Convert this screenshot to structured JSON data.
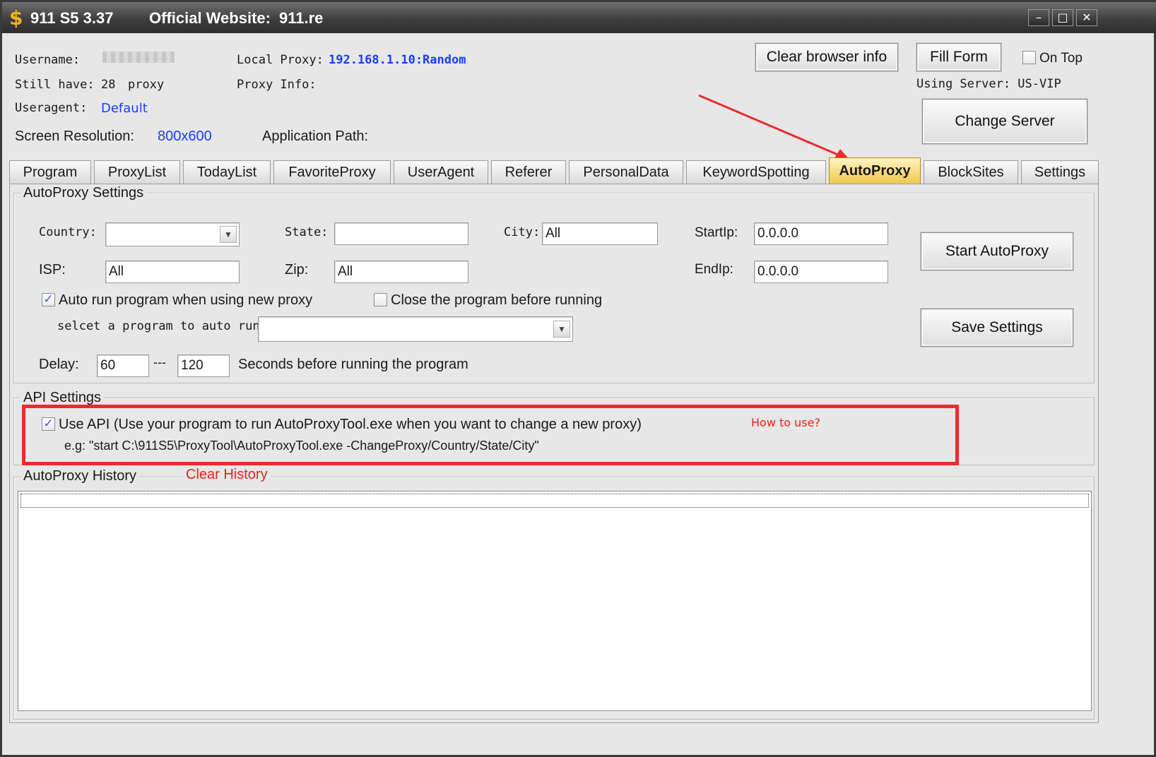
{
  "window": {
    "app_title": "911 S5 3.37",
    "website_label": "Official Website:",
    "website_value": "911.re",
    "minimize": "–",
    "maximize": "□",
    "close": "✕"
  },
  "info": {
    "username_label": "Username:",
    "still_have_label": "Still have:",
    "still_have_count": "28",
    "still_have_unit": "proxy",
    "useragent_label": "Useragent:",
    "useragent_value": "Default",
    "resolution_label": "Screen Resolution:",
    "resolution_value": "800x600",
    "local_proxy_label": "Local Proxy:",
    "local_proxy_value": "192.168.1.10:Random",
    "proxy_info_label": "Proxy Info:",
    "app_path_label": "Application Path:"
  },
  "top_controls": {
    "clear_browser": "Clear browser info",
    "fill_form": "Fill Form",
    "on_top": "On Top",
    "using_server": "Using Server: US-VIP",
    "change_server": "Change Server"
  },
  "tabs": [
    {
      "label": "Program"
    },
    {
      "label": "ProxyList"
    },
    {
      "label": "TodayList"
    },
    {
      "label": "FavoriteProxy"
    },
    {
      "label": "UserAgent"
    },
    {
      "label": "Referer"
    },
    {
      "label": "PersonalData"
    },
    {
      "label": "KeywordSpotting"
    },
    {
      "label": "AutoProxy"
    },
    {
      "label": "BlockSites"
    },
    {
      "label": "Settings"
    }
  ],
  "active_tab": "AutoProxy",
  "autoproxy": {
    "group_title": "AutoProxy Settings",
    "country_label": "Country:",
    "country_value": "",
    "state_label": "State:",
    "state_value": "",
    "city_label": "City:",
    "city_value": "All",
    "startip_label": "StartIp:",
    "startip_value": "0.0.0.0",
    "isp_label": "ISP:",
    "isp_value": "All",
    "zip_label": "Zip:",
    "zip_value": "All",
    "endip_label": "EndIp:",
    "endip_value": "0.0.0.0",
    "start_button": "Start AutoProxy",
    "save_button": "Save Settings",
    "auto_run_label": "Auto run program when using new proxy",
    "auto_run_checked": true,
    "close_before_label": "Close the program before running",
    "close_before_checked": false,
    "select_program_label": "selcet a program to auto run:",
    "select_program_value": "",
    "delay_label": "Delay:",
    "delay_min": "60",
    "delay_sep": "---",
    "delay_max": "120",
    "delay_suffix": "Seconds before running the program"
  },
  "api": {
    "group_title": "API Settings",
    "use_api_label": "Use API (Use your program to run AutoProxyTool.exe when you want to change a new proxy)",
    "use_api_checked": true,
    "example": "e.g: \"start C:\\911S5\\ProxyTool\\AutoProxyTool.exe -ChangeProxy/Country/State/City\"",
    "how_to_use": "How to use?"
  },
  "history": {
    "group_title": "AutoProxy History",
    "clear_history": "Clear History"
  },
  "colors": {
    "accent_blue": "#1a3dff",
    "annotation_red": "#ee2b2b",
    "active_tab": "#f1c649"
  }
}
